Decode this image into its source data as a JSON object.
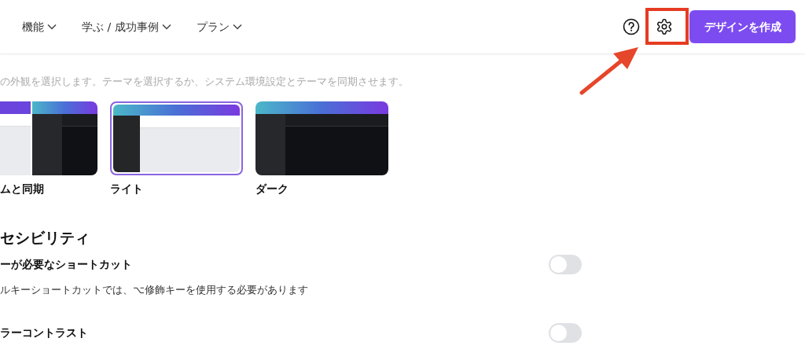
{
  "header": {
    "nav": [
      {
        "label": "機能"
      },
      {
        "label": "学ぶ / 成功事例"
      },
      {
        "label": "プラン"
      }
    ],
    "create_button": "デザインを作成"
  },
  "annotation": {
    "shown": true
  },
  "appearance": {
    "description": "の外観を選択します。テーマを選択するか、システム環境設定とテーマを同期させます。",
    "themes": [
      {
        "kind": "system",
        "label": "ムと同期",
        "selected": false
      },
      {
        "kind": "light",
        "label": "ライト",
        "selected": true
      },
      {
        "kind": "dark",
        "label": "ダーク",
        "selected": false
      }
    ]
  },
  "accessibility": {
    "heading": "セシビリティ",
    "rows": [
      {
        "label": "ーが必要なショートカット",
        "description": "ルキーショートカットでは、⌥修飾キーを使用する必要があります",
        "on": false
      },
      {
        "label": "ラーコントラスト",
        "on": false
      }
    ]
  }
}
